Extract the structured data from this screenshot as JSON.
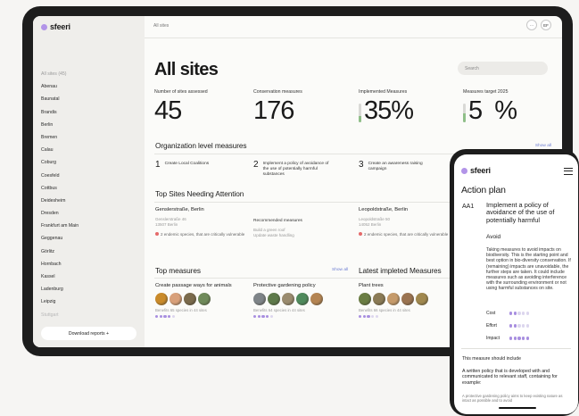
{
  "tablet": {
    "brand": "sfeeri",
    "breadcrumb": "All sites",
    "user_initials": "EF",
    "notification_label": "···",
    "page_title": "All sites",
    "search_placeholder": "Search",
    "sidebar": {
      "sites": [
        "All sites (45)",
        "Abenau",
        "Baunatal",
        "Brandis",
        "Berlin",
        "Bremen",
        "Calau",
        "Coburg",
        "Coesfeld",
        "Cottbus",
        "Deidesheim",
        "Dresden",
        "Frankfurt am Main",
        "Geggenau",
        "Görlitz",
        "Hornbach",
        "Kassel",
        "Ladenburg",
        "Leipzig",
        "Stuttgart"
      ],
      "download_label": "Download reports +"
    },
    "stats": [
      {
        "label": "Number of sites assessed",
        "value": "45",
        "bar": null
      },
      {
        "label": "Conservation measures",
        "value": "176",
        "bar": null
      },
      {
        "label": "Implemented Measures",
        "value": "35%",
        "bar": 0.35
      },
      {
        "label": "Measures target 2025",
        "value": "5  %",
        "bar": 0.5
      }
    ],
    "org_section": {
      "title": "Organization level measures",
      "show_all": "Show all",
      "items": [
        {
          "num": "1",
          "text": "Create Local Coalitions"
        },
        {
          "num": "2",
          "text": "Implement a policy of avoidance of the use of potentially harmful substances"
        },
        {
          "num": "3",
          "text": "Create an awareness raising campaign"
        }
      ]
    },
    "top_sites": {
      "title": "Top Sites Needing Attention",
      "sites": [
        {
          "name": "Genslerstraße, Berlin",
          "address_line1": "Genslerstraße 46",
          "address_line2": "13507 Berlin",
          "note": "2 endemic species, that are critically vulnerable"
        },
        {
          "name": "Leopoldstraße, Berlin",
          "address_line1": "Leopoldstraße 50",
          "address_line2": "14052 Berlin",
          "note": "2 endemic species, that are critically vulnerable"
        }
      ],
      "recommended": {
        "label": "Recommended measures",
        "line1": "Build a green roof",
        "line2": "Update waste handling"
      }
    },
    "top_measures": {
      "title": "Top measures",
      "show_all": "Show all",
      "items": [
        {
          "name": "Create passage ways for animals",
          "benefit": "Benefits 65 species in 44 sites",
          "rating": 4,
          "thumb_colors": [
            "#c98a2a",
            "#d8a07a",
            "#7a6a4c",
            "#6f8a5a"
          ]
        },
        {
          "name": "Protective gardening policy",
          "benefit": "Benefits 64 species in 44 sites",
          "rating": 4,
          "thumb_colors": [
            "#7e8488",
            "#5e7a4a",
            "#9a8b6e",
            "#4f8a5c",
            "#b48452"
          ]
        }
      ]
    },
    "latest_measures": {
      "title": "Latest impleted Measures",
      "items": [
        {
          "name": "Plant trees",
          "benefit": "Benefits 66 species in 44 sites",
          "rating": 3,
          "thumb_colors": [
            "#6a7d43",
            "#8a7a55",
            "#c59a6a",
            "#9a7350",
            "#a0884f"
          ]
        }
      ]
    }
  },
  "phone": {
    "brand": "sfeeri",
    "title": "Action plan",
    "code": "AA1",
    "measure_title": "Implement a policy of avoidance of the use of potentially harmful",
    "avoid_label": "Avoid",
    "description": "Taking measures to avoid impacts on biodiversity. This is the starting point and best option in bio-diversity conservation. If (remaining) impacts are unavoidable, the further steps are taken. It could include measures such as avoiding interference with the surrounding environment or not using harmful substances on site.",
    "ratings": [
      {
        "label": "Cost",
        "value": 2
      },
      {
        "label": "Effort",
        "value": 2
      },
      {
        "label": "Impact",
        "value": 5
      }
    ],
    "should_include_label": "This measure should include",
    "policy_text": "A written policy that is developed with and communicated to relevant staff, containing for example:",
    "policy_note": "A protective gardening policy aims to keep existing nature as intact as possible and to avoid"
  }
}
